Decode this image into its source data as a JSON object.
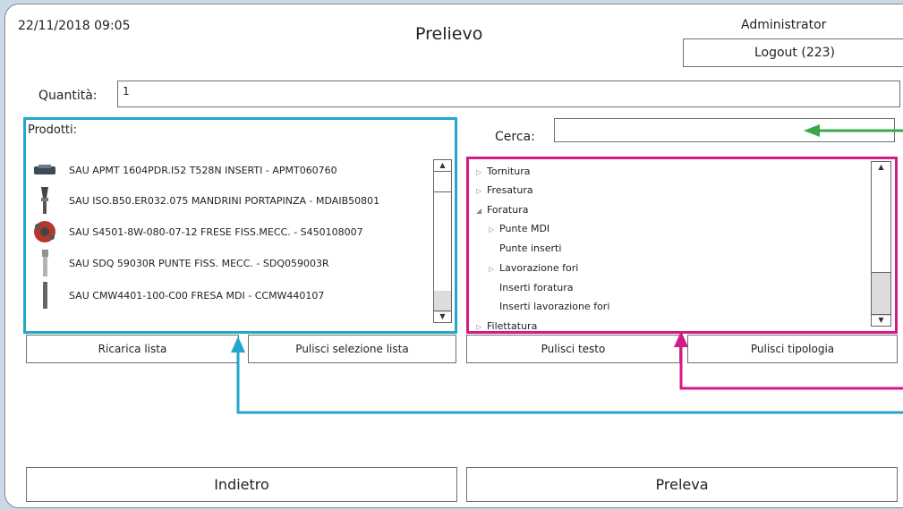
{
  "header": {
    "datetime": "22/11/2018 09:05",
    "title": "Prelievo",
    "user": "Administrator",
    "logout_label": "Logout (223)"
  },
  "quantity": {
    "label": "Quantità:",
    "value": "1"
  },
  "products": {
    "label": "Prodotti:",
    "items": [
      "SAU APMT 1604PDR.I52 T528N INSERTI - APMT060760",
      "SAU ISO.B50.ER032.075 MANDRINI PORTAPINZA - MDAIB50801",
      "SAU S4501-8W-080-07-12 FRESE FISS.MECC. - S450108007",
      "SAU SDQ 59030R PUNTE FISS. MECC. - SDQ059003R",
      "SAU CMW4401-100-C00 FRESA MDI - CCMW440107"
    ]
  },
  "search": {
    "label": "Cerca:",
    "value": ""
  },
  "tree": {
    "items": [
      {
        "label": "Tornitura",
        "expander": "collapsed"
      },
      {
        "label": "Fresatura",
        "expander": "collapsed"
      },
      {
        "label": "Foratura",
        "expander": "expanded"
      },
      {
        "label": "Punte MDI",
        "expander": "collapsed"
      },
      {
        "label": "Punte inserti",
        "expander": "none"
      },
      {
        "label": "Lavorazione fori",
        "expander": "collapsed"
      },
      {
        "label": "Inserti foratura",
        "expander": "none"
      },
      {
        "label": "Inserti lavorazione fori",
        "expander": "none"
      },
      {
        "label": "Filettatura",
        "expander": "collapsed"
      }
    ]
  },
  "buttons": {
    "reload_list": "Ricarica lista",
    "clear_list_selection": "Pulisci selezione lista",
    "clear_text": "Pulisci testo",
    "clear_type": "Pulisci tipologia",
    "back": "Indietro",
    "withdraw": "Preleva"
  },
  "colors": {
    "cyan_highlight": "#21a7cf",
    "magenta_highlight": "#d6188a",
    "green_arrow": "#3aa84a"
  }
}
